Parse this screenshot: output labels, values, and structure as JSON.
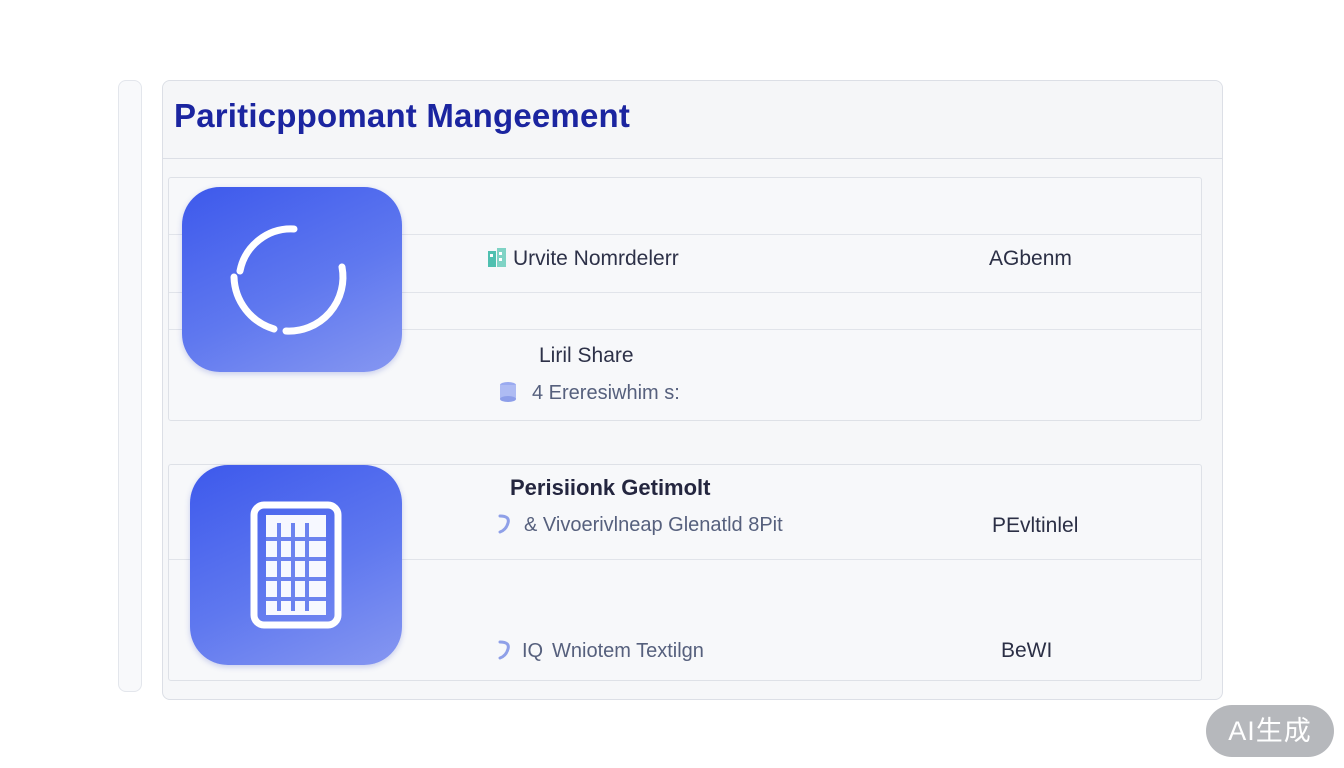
{
  "panel": {
    "title": "Pariticppomant Mangeement"
  },
  "sections": [
    {
      "items": [
        {
          "label": "Urvite Nomrdelerr",
          "value": "AGbenm",
          "icon": "teal-building-icon"
        },
        {
          "label": "Liril Share",
          "sub": "4 Ereresiwhim s:",
          "icon": "cylinder-icon"
        }
      ],
      "tile_icon": "refresh-circle-icon"
    },
    {
      "items": [
        {
          "label": "Perisiionk Getimolt",
          "sub": "& Vivoerivlneap Glenatld 8Pit",
          "value": "PEvltinlel",
          "icon": "s-curve-icon"
        },
        {
          "label": "Wniotem Textilgn",
          "prefix": "IQ",
          "value": "BeWI",
          "icon": "s-curve-icon"
        }
      ],
      "tile_icon": "grid-calendar-icon"
    }
  ],
  "badge": {
    "label": "AI生成"
  },
  "colors": {
    "title": "#1b25a0",
    "tile_start": "#3d59ec",
    "tile_end": "#8697f1",
    "card_bg": "#f6f7f9",
    "badge_bg": "#b6b8bc"
  }
}
